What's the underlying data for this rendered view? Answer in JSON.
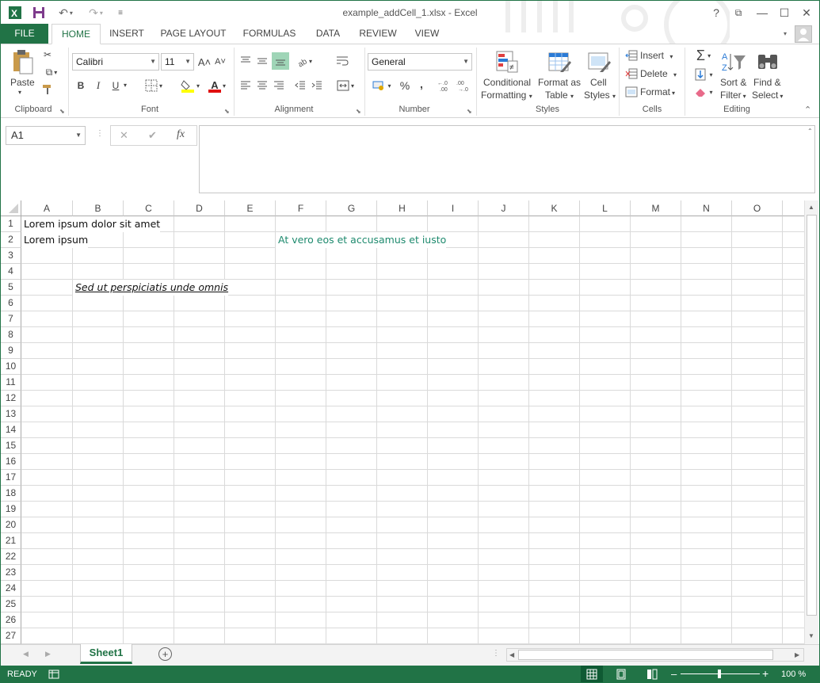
{
  "window": {
    "title": "example_addCell_1.xlsx - Excel",
    "help_label": "?",
    "restore_label": "⧉",
    "minimize_label": "—",
    "maximize_label": "☐",
    "close_label": "✕"
  },
  "tabs": [
    "FILE",
    "HOME",
    "INSERT",
    "PAGE LAYOUT",
    "FORMULAS",
    "DATA",
    "REVIEW",
    "VIEW"
  ],
  "ribbon": {
    "clipboard": {
      "paste": "Paste",
      "label": "Clipboard"
    },
    "font": {
      "name": "Calibri",
      "size": "11",
      "grow": "A˄",
      "shrink": "A˅",
      "bold": "B",
      "italic": "I",
      "underline": "U",
      "font_color": "A",
      "label": "Font"
    },
    "alignment": {
      "label": "Alignment"
    },
    "number": {
      "format": "General",
      "percent": "%",
      "comma": ",",
      "label": "Number"
    },
    "styles": {
      "conditional_1": "Conditional",
      "conditional_2": "Formatting",
      "format_table_1": "Format as",
      "format_table_2": "Table",
      "cell_styles_1": "Cell",
      "cell_styles_2": "Styles",
      "label": "Styles"
    },
    "cells": {
      "insert": "Insert",
      "delete": "Delete",
      "format": "Format",
      "label": "Cells"
    },
    "editing": {
      "sum": "Σ",
      "sort_1": "Sort &",
      "sort_2": "Filter",
      "find_1": "Find &",
      "find_2": "Select",
      "label": "Editing"
    }
  },
  "formula_bar": {
    "name_box": "A1",
    "cancel": "✕",
    "enter": "✔",
    "fx": "fx",
    "content": ""
  },
  "columns": [
    "A",
    "B",
    "C",
    "D",
    "E",
    "F",
    "G",
    "H",
    "I",
    "J",
    "K",
    "L",
    "M",
    "N",
    "O"
  ],
  "rows": [
    "1",
    "2",
    "3",
    "4",
    "5",
    "6",
    "7",
    "8",
    "9",
    "10",
    "11",
    "12",
    "13",
    "14",
    "15",
    "16",
    "17",
    "18",
    "19",
    "20",
    "21",
    "22",
    "23",
    "24",
    "25",
    "26",
    "27"
  ],
  "cells": {
    "A1": "Lorem ipsum dolor sit amet",
    "A2": "Lorem ipsum",
    "F2": "At vero eos et accusamus et iusto",
    "B5": "Sed ut perspiciatis unde omnis"
  },
  "colors": {
    "accent": "#217346",
    "f2_text": "#1e8a6e"
  },
  "sheets": {
    "active": "Sheet1",
    "add": "+"
  },
  "status": {
    "mode": "READY",
    "zoom": "100 %",
    "zoom_minus": "–",
    "zoom_plus": "+"
  }
}
